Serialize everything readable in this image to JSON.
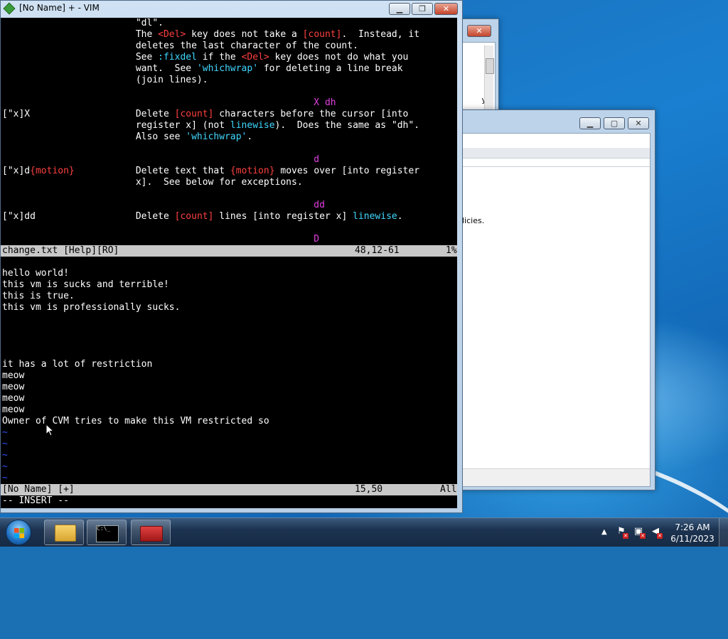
{
  "vim": {
    "title": "[No Name] + - VIM",
    "help_lines": [
      {
        "segs": [
          {
            "t": "                        \"dl\".",
            "c": ""
          }
        ]
      },
      {
        "segs": [
          {
            "t": "                        The ",
            "c": ""
          },
          {
            "t": "<Del>",
            "c": "red"
          },
          {
            "t": " key does not take a ",
            "c": ""
          },
          {
            "t": "[count]",
            "c": "red"
          },
          {
            "t": ".  Instead, it",
            "c": ""
          }
        ]
      },
      {
        "segs": [
          {
            "t": "                        deletes the last character of the count.",
            "c": ""
          }
        ]
      },
      {
        "segs": [
          {
            "t": "                        See ",
            "c": ""
          },
          {
            "t": ":fixdel",
            "c": "cyn"
          },
          {
            "t": " if the ",
            "c": ""
          },
          {
            "t": "<Del>",
            "c": "red"
          },
          {
            "t": " key does not do what you",
            "c": ""
          }
        ]
      },
      {
        "segs": [
          {
            "t": "                        want.  See ",
            "c": ""
          },
          {
            "t": "'whichwrap'",
            "c": "cyn"
          },
          {
            "t": " for deleting a line break",
            "c": ""
          }
        ]
      },
      {
        "segs": [
          {
            "t": "                        (join lines).",
            "c": ""
          }
        ]
      },
      {
        "segs": [
          {
            "t": "",
            "c": ""
          }
        ]
      },
      {
        "segs": [
          {
            "t": "                                                        X dh",
            "c": "mag"
          }
        ]
      },
      {
        "segs": [
          {
            "t": "[\"x]X                   Delete ",
            "c": ""
          },
          {
            "t": "[count]",
            "c": "red"
          },
          {
            "t": " characters before the cursor [into",
            "c": ""
          }
        ]
      },
      {
        "segs": [
          {
            "t": "                        register x] (not ",
            "c": ""
          },
          {
            "t": "linewise",
            "c": "cyn"
          },
          {
            "t": ").  Does the same as \"dh\".",
            "c": ""
          }
        ]
      },
      {
        "segs": [
          {
            "t": "                        Also see ",
            "c": ""
          },
          {
            "t": "'whichwrap'",
            "c": "cyn"
          },
          {
            "t": ".",
            "c": ""
          }
        ]
      },
      {
        "segs": [
          {
            "t": "",
            "c": ""
          }
        ]
      },
      {
        "segs": [
          {
            "t": "                                                        d",
            "c": "mag"
          }
        ]
      },
      {
        "segs": [
          {
            "t": "[\"x]d",
            "c": ""
          },
          {
            "t": "{motion}",
            "c": "red"
          },
          {
            "t": "           Delete text that ",
            "c": ""
          },
          {
            "t": "{motion}",
            "c": "red"
          },
          {
            "t": " moves over [into register",
            "c": ""
          }
        ]
      },
      {
        "segs": [
          {
            "t": "                        x].  See below for exceptions.",
            "c": ""
          }
        ]
      },
      {
        "segs": [
          {
            "t": "",
            "c": ""
          }
        ]
      },
      {
        "segs": [
          {
            "t": "                                                        dd",
            "c": "mag"
          }
        ]
      },
      {
        "segs": [
          {
            "t": "[\"x]dd                  Delete ",
            "c": ""
          },
          {
            "t": "[count]",
            "c": "red"
          },
          {
            "t": " lines [into register x] ",
            "c": ""
          },
          {
            "t": "linewise",
            "c": "cyn"
          },
          {
            "t": ".",
            "c": ""
          }
        ]
      },
      {
        "segs": [
          {
            "t": "",
            "c": ""
          }
        ]
      },
      {
        "segs": [
          {
            "t": "                                                        D",
            "c": "mag"
          }
        ]
      }
    ],
    "help_status": {
      "name": "change.txt [Help][RO]",
      "pos": "48,12-61",
      "pct": "1%"
    },
    "buffer_lines": [
      "hello world!",
      "this vm is sucks and terrible!",
      "this is true.",
      "this vm is professionally sucks.",
      "",
      "",
      "",
      "",
      "it has a lot of restriction",
      "meow",
      "meow",
      "meow",
      "meow",
      "Owner of CVM tries to make this VM restricted so"
    ],
    "tilde_lines": [
      "~",
      "~",
      "~",
      "~",
      "~"
    ],
    "buffer_status": {
      "name": "[No Name] [+]",
      "pos": "15,50",
      "pct": "All"
    },
    "mode_line": "-- INSERT --"
  },
  "back_window_a": {
    "partial_text": "yst"
  },
  "back_window_b": {
    "partial_text": "licies."
  },
  "taskbar": {
    "buttons": [
      {
        "name": "windows-explorer",
        "icon": "folder-icon"
      },
      {
        "name": "command-prompt",
        "icon": "cmd-icon",
        "label": "C:\\_"
      },
      {
        "name": "toolbox",
        "icon": "toolbox-icon"
      }
    ],
    "tray_arrow": "▲",
    "clock": {
      "time": "7:26 AM",
      "date": "6/11/2023"
    }
  }
}
